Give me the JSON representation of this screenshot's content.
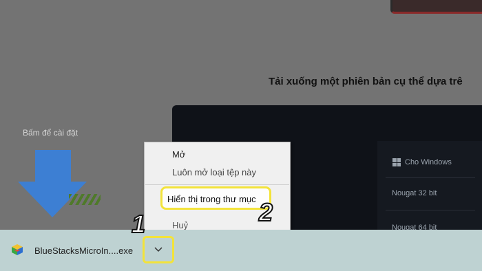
{
  "page": {
    "heading": "Tải xuống một phiên bản cụ thể dựa trê",
    "install_hint": "Bấm để cài đặt",
    "side_panel": {
      "windows_label": "Cho Windows",
      "row1": "Nougat 32 bit",
      "row2": "Nougat 64 bit"
    }
  },
  "context_menu": {
    "open": "Mở",
    "always_open": "Luôn mở loại tệp này",
    "show_in_folder": "Hiển thị trong thư mục",
    "cancel": "Huỷ"
  },
  "download_bar": {
    "filename": "BlueStacksMicroIn....exe",
    "chevron_icon": "chevron-down-icon"
  },
  "annotations": {
    "step1": "1",
    "step2": "2",
    "highlight_color": "#f3e33a"
  }
}
